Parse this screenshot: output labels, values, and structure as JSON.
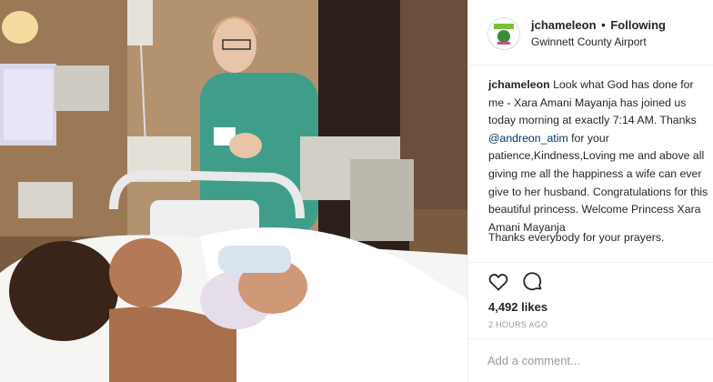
{
  "post": {
    "username": "jchameleon",
    "follow_separator": "•",
    "follow_status": "Following",
    "location": "Gwinnett County Airport",
    "avatar_icon": "profile-logo-icon"
  },
  "caption": {
    "username": "jchameleon",
    "text_before_mention": "Look what God has done for me - Xara Amani Mayanja has joined us today morning at exactly 7:14 AM. Thanks",
    "mention": "@andreon_atim",
    "text_after_mention": "for your patience,Kindness,Loving me and above all giving me all the happiness a wife can ever give to her husband. Congratulations for this beautiful princess. Welcome Princess Xara Amani Mayanja",
    "thanks_line": "Thanks everybody for your prayers."
  },
  "actions": {
    "like_icon": "heart-icon",
    "comment_icon": "comment-icon"
  },
  "likes": "4,492 likes",
  "time_ago": "2 HOURS AGO",
  "comment_box": {
    "placeholder": "Add a comment..."
  },
  "colors": {
    "mention": "#003569",
    "muted": "#999999",
    "text": "#262626",
    "divider": "#efefef"
  }
}
